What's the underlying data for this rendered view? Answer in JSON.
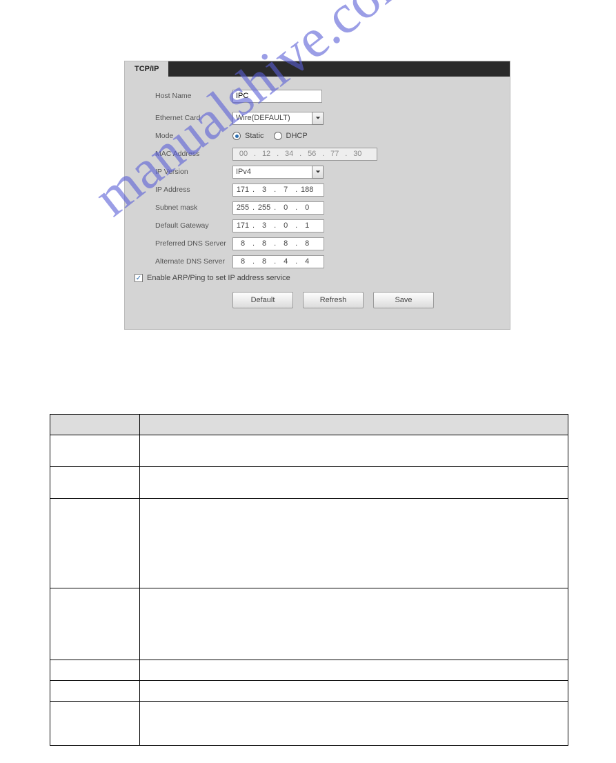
{
  "tab": {
    "label": "TCP/IP"
  },
  "form": {
    "host_name": {
      "label": "Host Name",
      "value": "IPC"
    },
    "ethernet_card": {
      "label": "Ethernet Card",
      "value": "Wire(DEFAULT)"
    },
    "mode": {
      "label": "Mode",
      "static": "Static",
      "dhcp": "DHCP"
    },
    "mac": {
      "label": "MAC Address",
      "segs": [
        "00",
        "12",
        "34",
        "56",
        "77",
        "30"
      ]
    },
    "ip_version": {
      "label": "IP Version",
      "value": "IPv4"
    },
    "ip_addr": {
      "label": "IP Address",
      "segs": [
        "171",
        "3",
        "7",
        "188"
      ]
    },
    "subnet": {
      "label": "Subnet mask",
      "segs": [
        "255",
        "255",
        "0",
        "0"
      ]
    },
    "gateway": {
      "label": "Default Gateway",
      "segs": [
        "171",
        "3",
        "0",
        "1"
      ]
    },
    "pref_dns": {
      "label": "Preferred DNS Server",
      "segs": [
        "8",
        "8",
        "8",
        "8"
      ]
    },
    "alt_dns": {
      "label": "Alternate DNS Server",
      "segs": [
        "8",
        "8",
        "4",
        "4"
      ]
    },
    "arp_check": "Enable ARP/Ping to set IP address service",
    "buttons": {
      "default": "Default",
      "refresh": "Refresh",
      "save": "Save"
    }
  },
  "watermark": "manualshive.com",
  "table_rows_heights": [
    30,
    46,
    46,
    130,
    104,
    30,
    30,
    64
  ]
}
